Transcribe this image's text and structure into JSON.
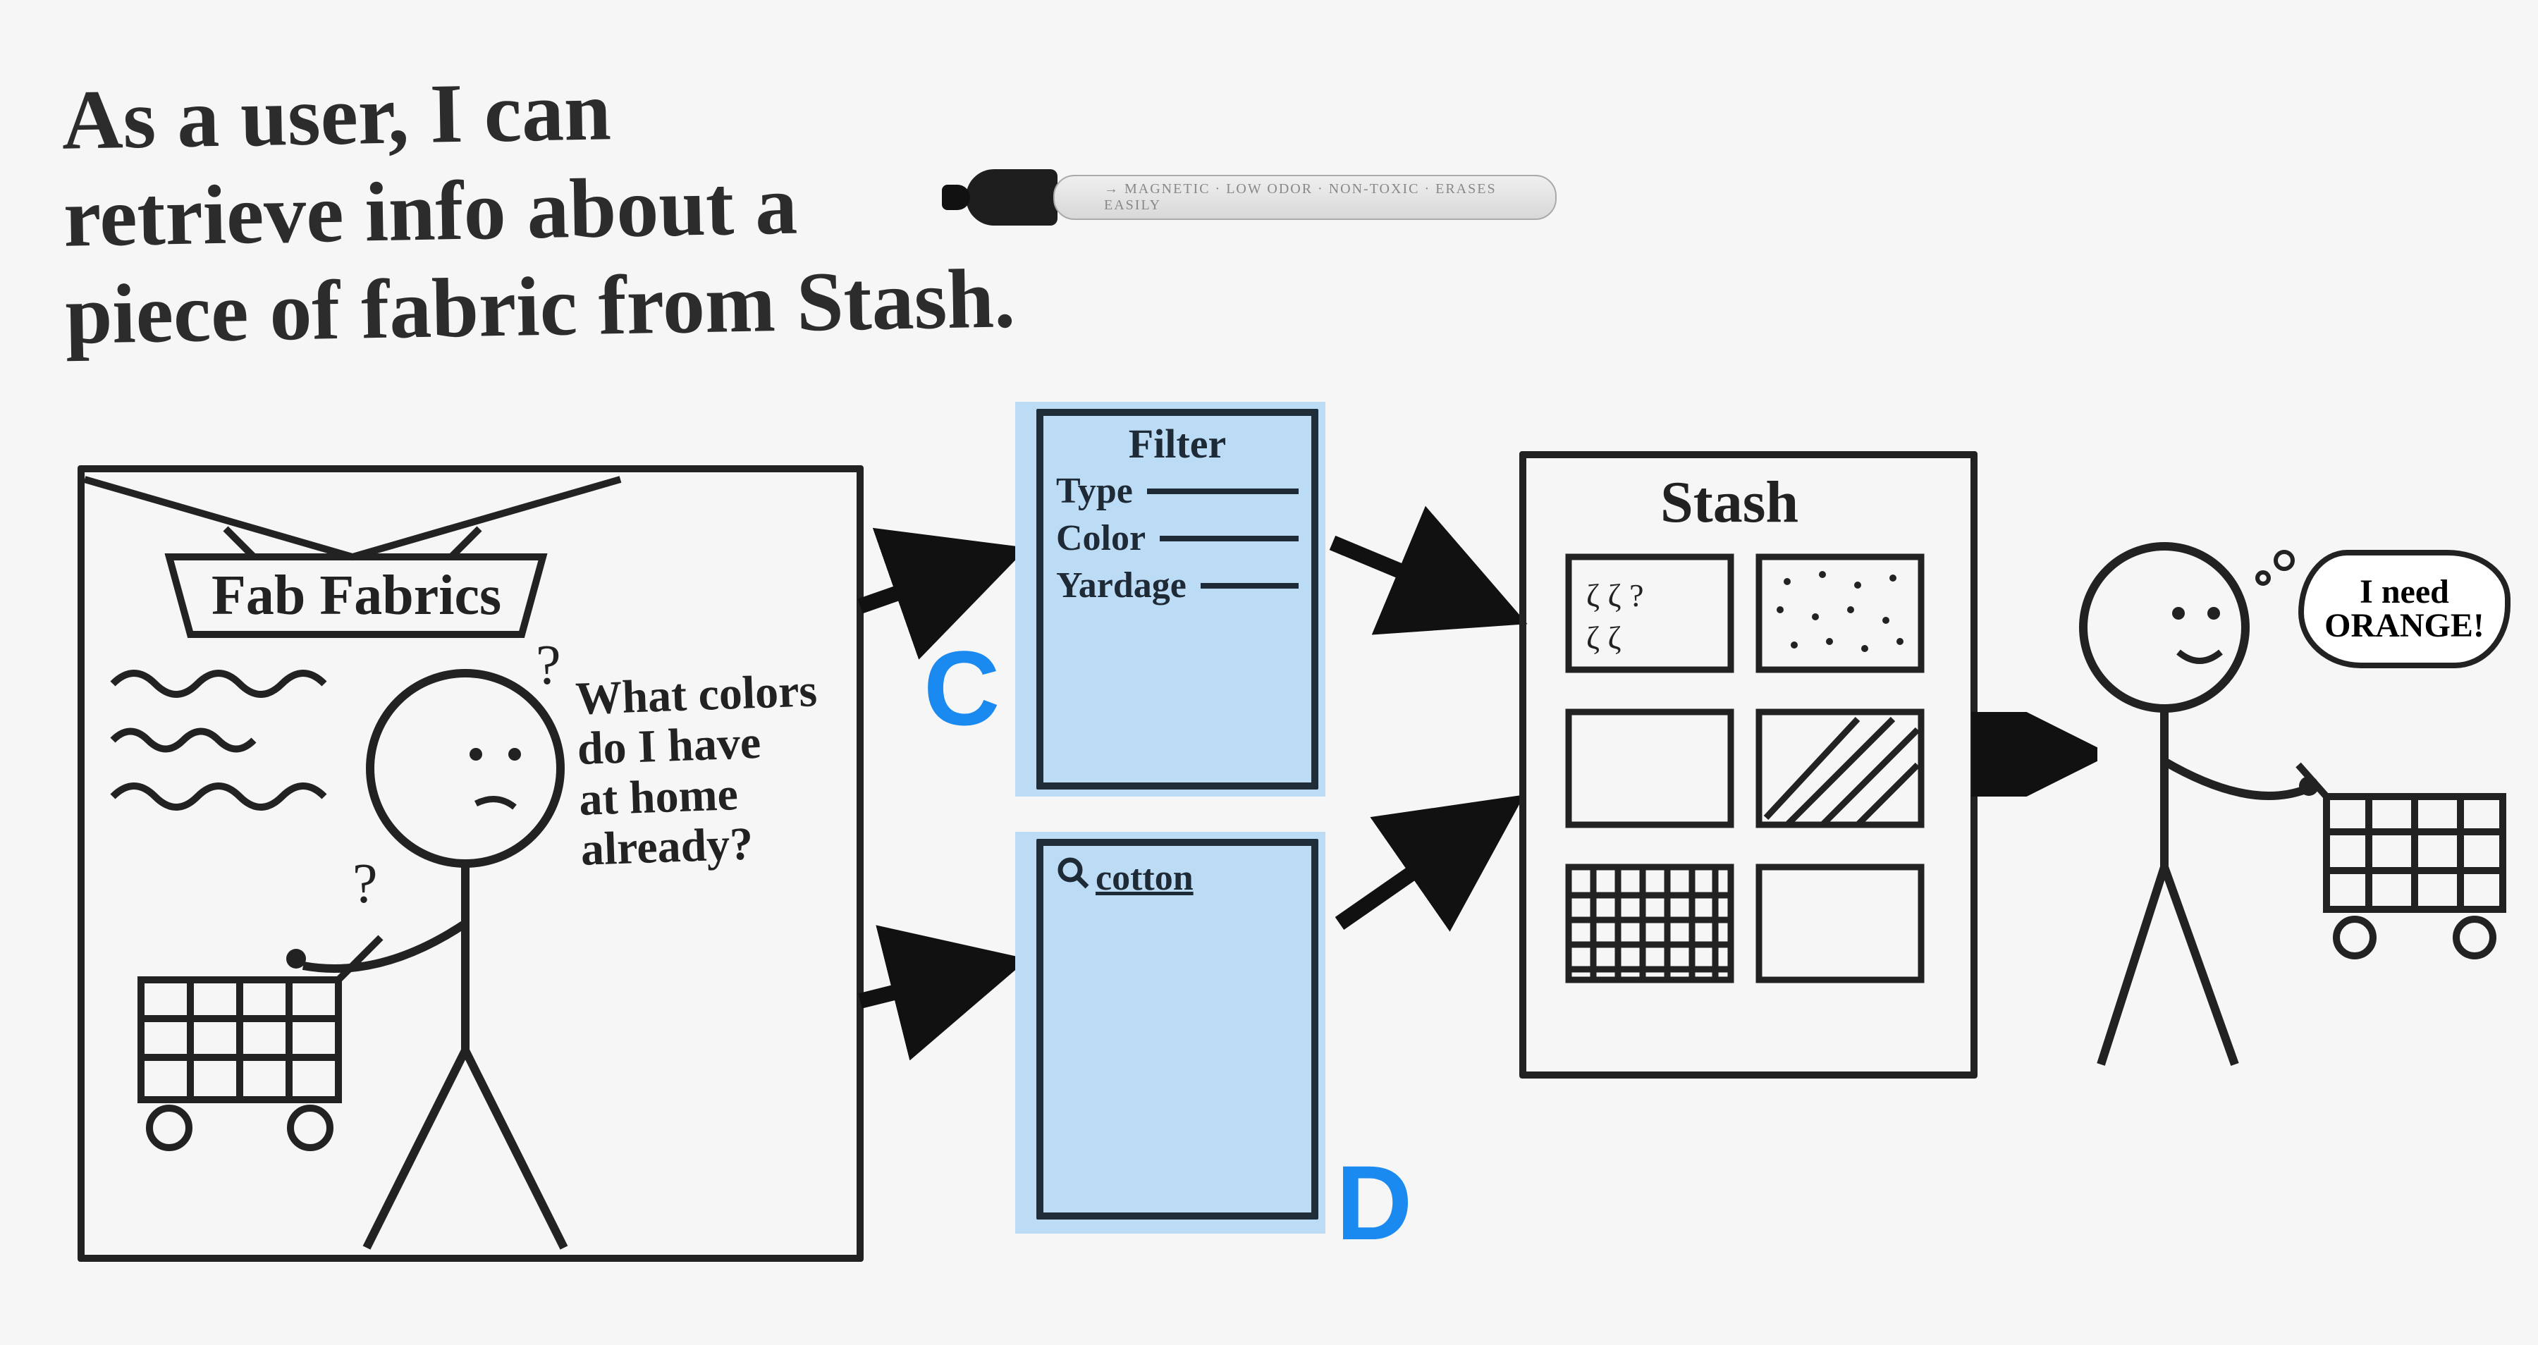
{
  "user_story": "As a user, I can\nretrieve info about a\npiece of fabric from Stash.",
  "marker_label": "→  MAGNETIC · LOW ODOR · NON-TOXIC · ERASES EASILY",
  "scene1": {
    "store_sign": "Fab Fabrics",
    "question": "What colors\ndo I have\nat home\nalready?"
  },
  "option_c": {
    "letter": "C",
    "title": "Filter",
    "rows": [
      "Type",
      "Color",
      "Yardage"
    ]
  },
  "option_d": {
    "letter": "D",
    "search_term": "cotton"
  },
  "stash": {
    "title": "Stash"
  },
  "scene2": {
    "thought": "I need\nORANGE!"
  }
}
